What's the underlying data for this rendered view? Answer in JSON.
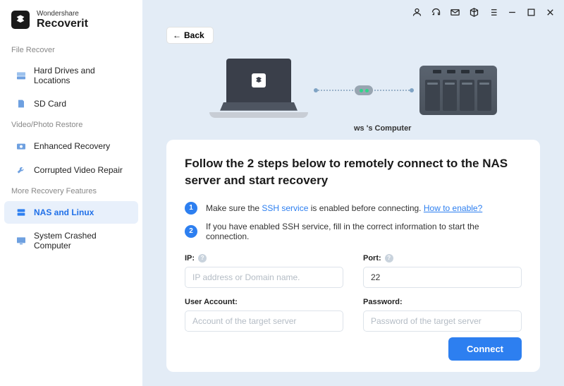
{
  "brand": {
    "top": "Wondershare",
    "bottom": "Recoverit"
  },
  "sections": {
    "file_recover": {
      "title": "File Recover",
      "items": [
        "Hard Drives and Locations",
        "SD Card"
      ]
    },
    "video_restore": {
      "title": "Video/Photo Restore",
      "items": [
        "Enhanced Recovery",
        "Corrupted Video Repair"
      ]
    },
    "more": {
      "title": "More Recovery Features",
      "items": [
        "NAS and Linux",
        "System Crashed Computer"
      ]
    }
  },
  "back_label": "Back",
  "computer_label": "ws 's Computer",
  "panel": {
    "title": "Follow the 2 steps below to remotely connect to the NAS server and start recovery",
    "step1_pre": "Make sure the ",
    "step1_link": "SSH service",
    "step1_post": " is enabled before connecting. ",
    "step1_link2": "How to enable?",
    "step2": "If you have enabled SSH service, fill in the correct information to start the connection."
  },
  "form": {
    "ip_label": "IP:",
    "ip_placeholder": "IP address or Domain name.",
    "port_label": "Port:",
    "port_value": "22",
    "user_label": "User Account:",
    "user_placeholder": "Account of the target server",
    "password_label": "Password:",
    "password_placeholder": "Password of the target server"
  },
  "connect_label": "Connect"
}
